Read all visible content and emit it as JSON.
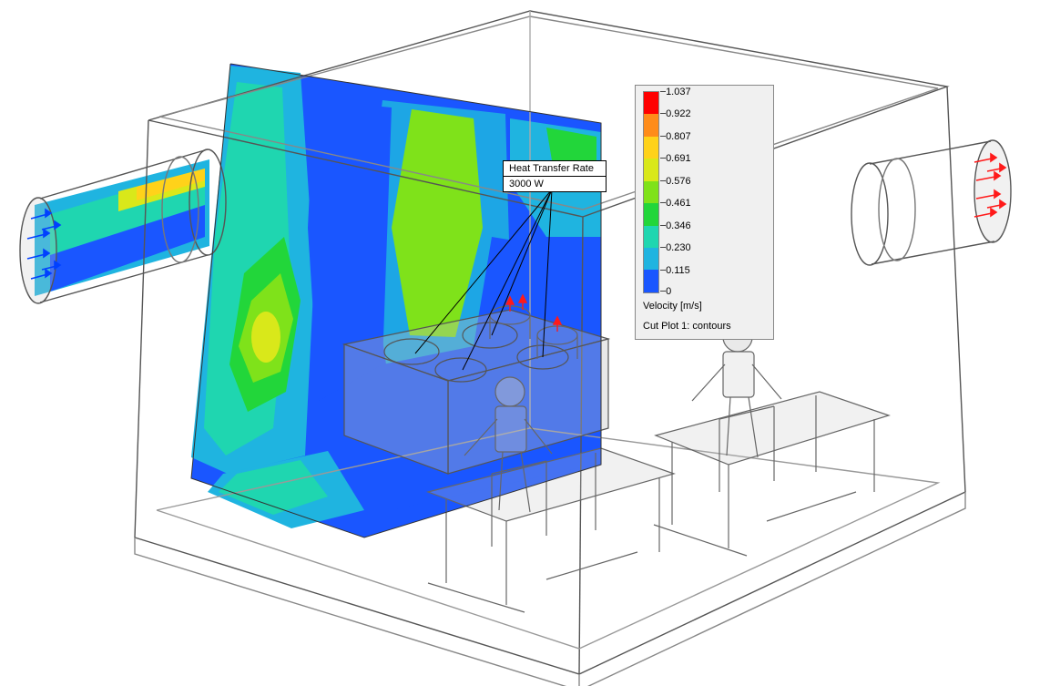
{
  "callout": {
    "title": "Heat Transfer Rate",
    "value": "3000 W"
  },
  "legend": {
    "title": "Velocity [m/s]",
    "subtitle": "Cut Plot 1: contours",
    "ticks": [
      "1.037",
      "0.922",
      "0.807",
      "0.691",
      "0.576",
      "0.461",
      "0.346",
      "0.230",
      "0.115",
      "0"
    ],
    "colors": [
      "#ff0000",
      "#ff8c1a",
      "#ffd21a",
      "#d9e81a",
      "#7fe21a",
      "#22d63a",
      "#1fd6b0",
      "#1fb4e0",
      "#1a56ff"
    ]
  },
  "chart_data": {
    "type": "contour",
    "field": "Velocity",
    "unit": "m/s",
    "range": [
      0,
      1.037
    ],
    "levels": [
      0,
      0.115,
      0.23,
      0.346,
      0.461,
      0.576,
      0.691,
      0.807,
      0.922,
      1.037
    ],
    "colormap": [
      "#1a56ff",
      "#1fb4e0",
      "#1fd6b0",
      "#22d63a",
      "#7fe21a",
      "#d9e81a",
      "#ffd21a",
      "#ff8c1a",
      "#ff0000"
    ],
    "plot_name": "Cut Plot 1: contours",
    "annotations": [
      {
        "label": "Heat Transfer Rate",
        "value": 3000,
        "unit": "W",
        "location": "stove-top"
      }
    ],
    "boundary_conditions": [
      {
        "name": "inlet-duct",
        "side": "left",
        "flow_direction": "into-room",
        "arrow_color": "blue"
      },
      {
        "name": "outlet-duct",
        "side": "right",
        "flow_direction": "out-of-room",
        "arrow_color": "red"
      }
    ],
    "geometry_note": "Isometric transparent room with two cylindrical ducts (left inlet, right outlet), a stove/cooktop block under the cut plane, and two seated mannequins at desks. Cut plane slices vertically through the stove; contour field shows mostly 0–0.35 m/s (blues/cyans) with a few green/yellow plumes (~0.5–0.8 m/s) near the inlet jet and above the hot cooktop."
  }
}
